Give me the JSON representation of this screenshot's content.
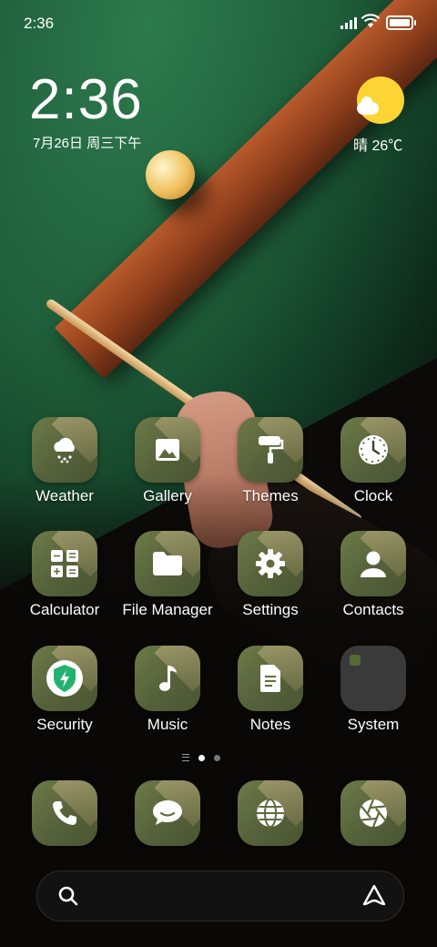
{
  "status_bar": {
    "time": "2:36"
  },
  "clock_widget": {
    "time": "2:36",
    "date": "7月26日 周三下午"
  },
  "weather_widget": {
    "text": "晴 26℃",
    "icon": "sun-cloud-icon"
  },
  "apps_row1": [
    {
      "label": "Weather",
      "icon": "weather-snow-cloud-icon"
    },
    {
      "label": "Gallery",
      "icon": "image-icon"
    },
    {
      "label": "Themes",
      "icon": "paint-roller-icon"
    },
    {
      "label": "Clock",
      "icon": "clock-icon"
    }
  ],
  "apps_row2": [
    {
      "label": "Calculator",
      "icon": "calculator-icon"
    },
    {
      "label": "File Manager",
      "icon": "folder-icon"
    },
    {
      "label": "Settings",
      "icon": "gear-icon"
    },
    {
      "label": "Contacts",
      "icon": "person-icon"
    }
  ],
  "apps_row3": [
    {
      "label": "Security",
      "icon": "shield-lightning-icon"
    },
    {
      "label": "Music",
      "icon": "music-note-icon"
    },
    {
      "label": "Notes",
      "icon": "document-icon"
    },
    {
      "label": "System",
      "icon": "folder-grid-icon"
    }
  ],
  "dock": [
    {
      "icon": "phone-icon"
    },
    {
      "icon": "message-icon"
    },
    {
      "icon": "globe-icon"
    },
    {
      "icon": "camera-aperture-icon"
    }
  ],
  "page_indicator": {
    "pages": 2,
    "active": 1
  },
  "colors": {
    "icon_bg": "#5f6b3e",
    "weather_sun": "#fcd535",
    "security_green": "#23b26d"
  }
}
